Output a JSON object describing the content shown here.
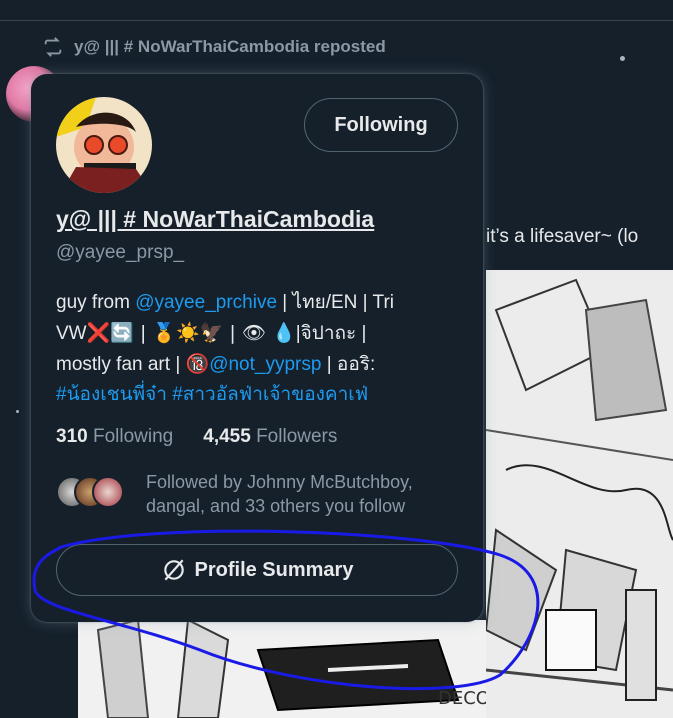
{
  "background": {
    "repost_text": "y@ ||| # NoWarThaiCambodia reposted",
    "obscured_name": "‎",
    "post_text": "it’s a lifesaver~ (lo",
    "artwork_signature": "DECOSKE"
  },
  "hover_card": {
    "follow_button_label": "Following",
    "display_name": "y@ ||| # NoWarThaiCambodia",
    "handle": "@yayee_prsp_",
    "bio": {
      "line1_prefix": "guy from ",
      "line1_link": "@yayee_prchive",
      "line1_suffix": " | ไทย/EN | Tri",
      "line2_prefix": "VW",
      "line2_emoji_a": "❌🔄 | 🏅☀️🦅 | 👁 💧",
      "line2_suffix": "|จิปาถะ |",
      "line3_prefix": "mostly fan art | ",
      "line3_emoji": "🔞",
      "line3_link": "@not_yyprsp",
      "line3_suffix": " | ออริ:",
      "line4_hashtags": "#น้องเชนพี่จ๋า #สาวอัลฟ่าเจ้าของคาเฟ่"
    },
    "stats": {
      "following_count": "310",
      "following_label": "Following",
      "followers_count": "4,455",
      "followers_label": "Followers"
    },
    "followed_by_text": "Followed by Johnny McButchboy, dangal, and 33 others you follow",
    "summary_button_label": "Profile Summary",
    "icons": {
      "repost": "repost-icon",
      "summary": "grok-icon"
    }
  },
  "colors": {
    "background": "#15202b",
    "link": "#1d9bf0",
    "secondary_text": "#8b98a5",
    "annotation_circle": "#1a1ae6"
  }
}
